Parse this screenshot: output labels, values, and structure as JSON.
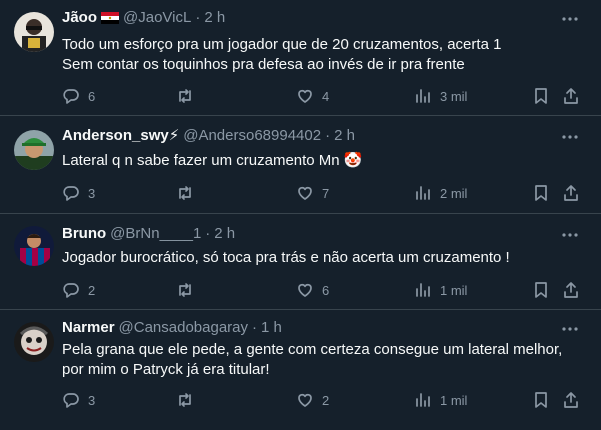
{
  "tweets": [
    {
      "name": "Jãoo",
      "badge": "flag-egypt",
      "handle": "@JaoVicL",
      "sep": "·",
      "age": "2 h",
      "lines": [
        "Todo um esforço pra um jogador que de 20 cruzamentos, acerta 1",
        "Sem contar os toquinhos pra defesa ao invés de ir pra frente"
      ],
      "replies": "6",
      "retweets": "",
      "likes": "4",
      "views": "3 mil"
    },
    {
      "name": "Anderson_swy⚡",
      "handle": "@Anderso68994402",
      "sep": "·",
      "age": "2 h",
      "lines": [
        "Lateral q n sabe fazer um cruzamento Mn 🤡"
      ],
      "replies": "3",
      "retweets": "",
      "likes": "7",
      "views": "2 mil"
    },
    {
      "name": "Bruno",
      "handle": "@BrNn____1",
      "sep": "·",
      "age": "2 h",
      "lines": [
        "Jogador burocrático, só toca pra trás e não acerta um cruzamento !"
      ],
      "replies": "2",
      "retweets": "",
      "likes": "6",
      "views": "1 mil"
    },
    {
      "name": "Narmer",
      "handle": "@Cansadobagaray",
      "sep": "·",
      "age": "1 h",
      "lines": [
        "Pela grana que ele pede, a gente com certeza consegue um lateral melhor,",
        "por mim o Patryck já era titular!"
      ],
      "replies": "3",
      "retweets": "",
      "likes": "2",
      "views": "1 mil"
    }
  ],
  "colors": {
    "background": "#15202b",
    "text": "#f7f9f9",
    "muted": "#8b98a5",
    "divider": "#38444d"
  }
}
